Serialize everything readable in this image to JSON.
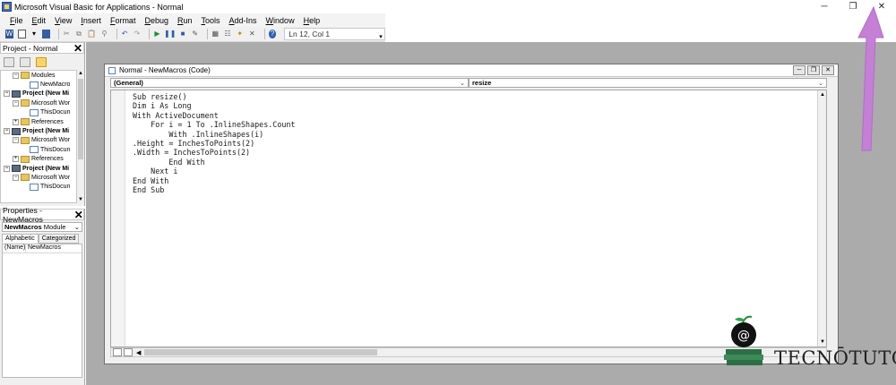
{
  "window": {
    "title": "Microsoft Visual Basic for Applications - Normal",
    "minimize": "─",
    "restore": "❐",
    "close": "✕"
  },
  "menu": {
    "items": [
      {
        "label": "File"
      },
      {
        "label": "Edit"
      },
      {
        "label": "View"
      },
      {
        "label": "Insert"
      },
      {
        "label": "Format"
      },
      {
        "label": "Debug"
      },
      {
        "label": "Run"
      },
      {
        "label": "Tools"
      },
      {
        "label": "Add-Ins"
      },
      {
        "label": "Window"
      },
      {
        "label": "Help"
      }
    ]
  },
  "toolbar": {
    "status": "Ln 12, Col 1"
  },
  "project_pane": {
    "title": "Project - Normal",
    "close": "✕",
    "tree": [
      {
        "label": "Modules",
        "indent": 1,
        "kind": "folder",
        "expander": "−"
      },
      {
        "label": "NewMacro",
        "indent": 2,
        "kind": "module",
        "expander": ""
      },
      {
        "label": "Project (New Mi",
        "indent": 0,
        "kind": "project",
        "expander": "−",
        "bold": true
      },
      {
        "label": "Microsoft Wor",
        "indent": 1,
        "kind": "folder",
        "expander": "−"
      },
      {
        "label": "ThisDocun",
        "indent": 2,
        "kind": "module",
        "expander": ""
      },
      {
        "label": "References",
        "indent": 1,
        "kind": "folder",
        "expander": "+"
      },
      {
        "label": "Project (New Mi",
        "indent": 0,
        "kind": "project",
        "expander": "−",
        "bold": true
      },
      {
        "label": "Microsoft Wor",
        "indent": 1,
        "kind": "folder",
        "expander": "−"
      },
      {
        "label": "ThisDocun",
        "indent": 2,
        "kind": "module",
        "expander": ""
      },
      {
        "label": "References",
        "indent": 1,
        "kind": "folder",
        "expander": "+"
      },
      {
        "label": "Project (New Mi",
        "indent": 0,
        "kind": "project",
        "expander": "−",
        "bold": true
      },
      {
        "label": "Microsoft Wor",
        "indent": 1,
        "kind": "folder",
        "expander": "−"
      },
      {
        "label": "ThisDocun",
        "indent": 2,
        "kind": "module",
        "expander": ""
      }
    ]
  },
  "properties_pane": {
    "title": "Properties - NewMacros",
    "close": "✕",
    "object_name": "NewMacros",
    "object_type": "Module",
    "tabs": [
      "Alphabetic",
      "Categorized"
    ],
    "rows": [
      {
        "name": "(Name)",
        "value": "NewMacros"
      }
    ]
  },
  "code_window": {
    "title": "Normal - NewMacros (Code)",
    "object_combo": "(General)",
    "proc_combo": "resize",
    "lines": [
      "Sub resize()",
      "Dim i As Long",
      "With ActiveDocument",
      "    For i = 1 To .InlineShapes.Count",
      "        With .InlineShapes(i)",
      ".Height = InchesToPoints(2)",
      ".Width = InchesToPoints(2)",
      "        End With",
      "    Next i",
      "End With",
      "End Sub"
    ]
  },
  "watermark": {
    "text": "TECNŌTUTO"
  },
  "colors": {
    "accent_arrow": "#c57fd6",
    "mdi_background": "#ababab",
    "code_keyword": "#1f3fa3"
  }
}
